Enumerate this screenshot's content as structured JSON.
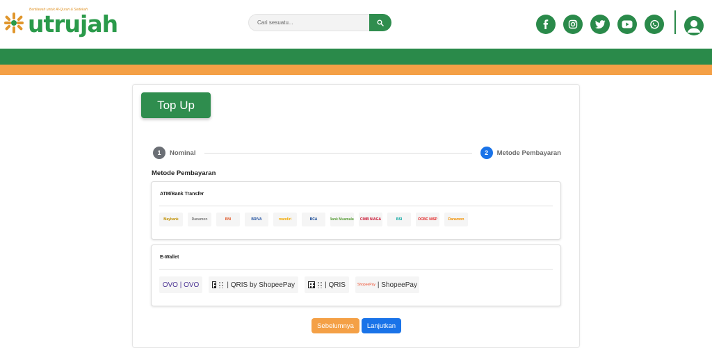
{
  "brand": {
    "name": "utrujah",
    "tagline": "Bertilawah untuk Al-Quran & Sedekah",
    "colors": {
      "green": "#2a8a4a",
      "orange": "#f4a046",
      "blue": "#1a73e8"
    }
  },
  "search": {
    "placeholder": "Cari sesuatu...",
    "icon": "search-icon"
  },
  "social": [
    {
      "name": "facebook",
      "glyph": "f"
    },
    {
      "name": "instagram",
      "glyph": "◎"
    },
    {
      "name": "twitter",
      "glyph": "🐦"
    },
    {
      "name": "youtube",
      "glyph": "▶"
    },
    {
      "name": "whatsapp",
      "glyph": "✆"
    }
  ],
  "page": {
    "title": "Top Up"
  },
  "steps": [
    {
      "number": "1",
      "label": "Nominal"
    },
    {
      "number": "2",
      "label": "Metode Pembayaran"
    }
  ],
  "payment": {
    "section_title": "Metode Pembayaran",
    "bank_title": "ATM/Bank Transfer",
    "banks": [
      {
        "name": "Maybank",
        "color": "#c09000"
      },
      {
        "name": "Danamon",
        "color": "#7a7a7a"
      },
      {
        "name": "BNI",
        "color": "#e05a2b"
      },
      {
        "name": "BRIVA",
        "color": "#1d4e9e"
      },
      {
        "name": "mandiri",
        "color": "#f2a900"
      },
      {
        "name": "BCA",
        "color": "#0a3f8f"
      },
      {
        "name": "Bank Muamalat",
        "color": "#5a9e3a"
      },
      {
        "name": "CIMB NIAGA",
        "color": "#c8102e"
      },
      {
        "name": "BSI",
        "color": "#00a39d"
      },
      {
        "name": "OCBC NISP",
        "color": "#e02020"
      },
      {
        "name": "Danamon",
        "color": "#f09000"
      }
    ],
    "wallet_title": "E-Wallet",
    "wallets": [
      {
        "name": "OVO",
        "label": "OVO | OVO"
      },
      {
        "name": "QRIS by ShopeePay",
        "label": "| QRIS by ShopeePay"
      },
      {
        "name": "QRIS",
        "label": "| QRIS"
      },
      {
        "name": "ShopeePay",
        "label": "| ShopeePay",
        "logo_text": "ShopeePay"
      }
    ]
  },
  "buttons": {
    "prev": "Sebelumnya",
    "next": "Lanjutkan"
  }
}
